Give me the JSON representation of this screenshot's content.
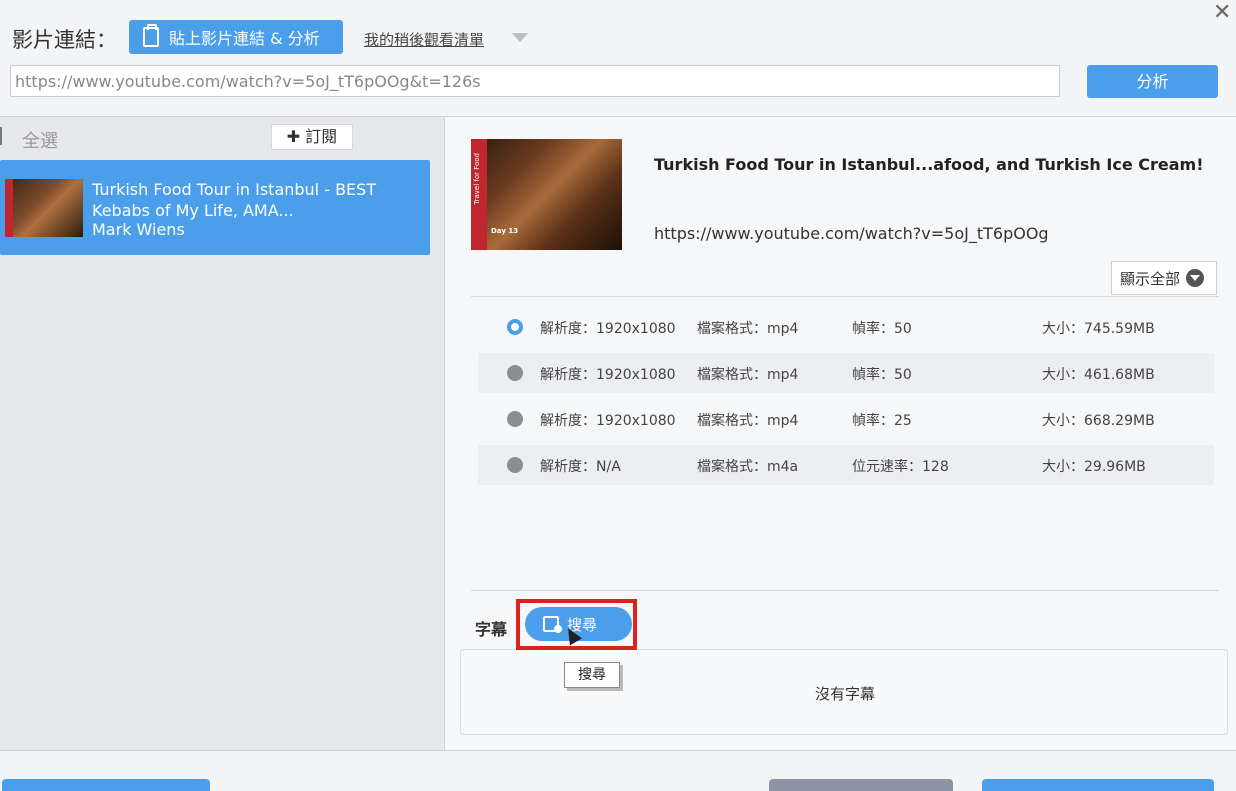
{
  "header": {
    "link_label": "影片連結：",
    "paste_button_label": "貼上影片連結 & 分析",
    "watch_later_label": "我的稍後觀看清單",
    "close_label": "✕",
    "url_value": "https://www.youtube.com/watch?v=5oJ_tT6pOOg&t=126s",
    "analyze_button_label": "分析"
  },
  "sidebar": {
    "all_label": "全選",
    "subscribe_label": "✚ 訂閱",
    "items": [
      {
        "title": "Turkish Food Tour in Istanbul - BEST Kebabs of My Life, AMA...",
        "author": "Mark Wiens"
      }
    ]
  },
  "detail": {
    "thumb_side_text": "Travel for Food",
    "thumb_day_text": "Day 13",
    "title": "Turkish Food Tour in Istanbul...afood, and Turkish Ice Cream!",
    "url": "https://www.youtube.com/watch?v=5oJ_tT6pOOg",
    "show_all_label": "顯示全部",
    "formats": [
      {
        "resolution": "解析度：1920x1080",
        "format": "檔案格式：mp4",
        "rate": "幀率：50",
        "size": "大小：745.59MB",
        "selected": true
      },
      {
        "resolution": "解析度：1920x1080",
        "format": "檔案格式：mp4",
        "rate": "幀率：50",
        "size": "大小：461.68MB",
        "selected": false
      },
      {
        "resolution": "解析度：1920x1080",
        "format": "檔案格式：mp4",
        "rate": "幀率：25",
        "size": "大小：668.29MB",
        "selected": false
      },
      {
        "resolution": "解析度：N/A",
        "format": "檔案格式：m4a",
        "rate": "位元速率：128",
        "size": "大小：29.96MB",
        "selected": false
      }
    ],
    "subtitle_label": "字幕",
    "search_button_label": "搜尋",
    "tooltip_text": "搜尋",
    "no_subtitle_text": "沒有字幕"
  },
  "colors": {
    "accent": "#4a9eea",
    "highlight": "#e0201c"
  }
}
